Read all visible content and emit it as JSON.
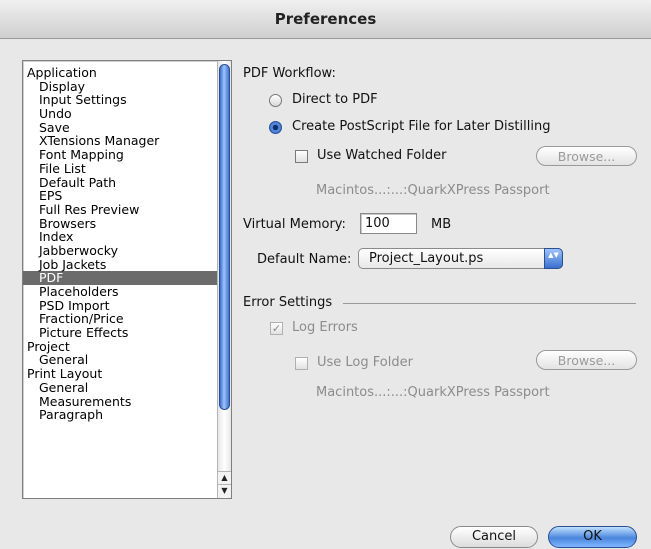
{
  "window": {
    "title": "Preferences"
  },
  "sidebar": {
    "items": [
      {
        "label": "Application",
        "level": 0
      },
      {
        "label": "Display",
        "level": 1
      },
      {
        "label": "Input Settings",
        "level": 1
      },
      {
        "label": "Undo",
        "level": 1
      },
      {
        "label": "Save",
        "level": 1
      },
      {
        "label": "XTensions Manager",
        "level": 1
      },
      {
        "label": "Font Mapping",
        "level": 1
      },
      {
        "label": "File List",
        "level": 1
      },
      {
        "label": "Default Path",
        "level": 1
      },
      {
        "label": "EPS",
        "level": 1
      },
      {
        "label": "Full Res Preview",
        "level": 1
      },
      {
        "label": "Browsers",
        "level": 1
      },
      {
        "label": "Index",
        "level": 1
      },
      {
        "label": "Jabberwocky",
        "level": 1
      },
      {
        "label": "Job Jackets",
        "level": 1
      },
      {
        "label": "PDF",
        "level": 1,
        "selected": true
      },
      {
        "label": "Placeholders",
        "level": 1
      },
      {
        "label": "PSD Import",
        "level": 1
      },
      {
        "label": "Fraction/Price",
        "level": 1
      },
      {
        "label": "Picture Effects",
        "level": 1
      },
      {
        "label": "Project",
        "level": 0
      },
      {
        "label": "General",
        "level": 1
      },
      {
        "label": "Print Layout",
        "level": 0
      },
      {
        "label": "General",
        "level": 1
      },
      {
        "label": "Measurements",
        "level": 1
      },
      {
        "label": "Paragraph",
        "level": 1
      }
    ],
    "scroll_up_glyph": "▲",
    "scroll_down_glyph": "▼"
  },
  "pdf": {
    "workflow_label": "PDF Workflow:",
    "direct_label": "Direct to PDF",
    "postscript_label": "Create PostScript File for Later Distilling",
    "selected_workflow": "postscript",
    "watched_folder_label": "Use Watched Folder",
    "watched_folder_checked": false,
    "browse_label": "Browse...",
    "watched_folder_path": "Macintos...:...:QuarkXPress Passport",
    "virtual_memory_label": "Virtual Memory:",
    "virtual_memory_value": "100",
    "virtual_memory_unit": "MB",
    "default_name_label": "Default Name:",
    "default_name_value": "Project_Layout.ps",
    "popup_arrows": "▲▼"
  },
  "errors": {
    "section_label": "Error Settings",
    "log_errors_label": "Log Errors",
    "log_errors_checked": true,
    "check_glyph": "✓",
    "use_log_folder_label": "Use Log Folder",
    "use_log_folder_checked": false,
    "browse_label": "Browse...",
    "log_folder_path": "Macintos...:...:QuarkXPress Passport"
  },
  "footer": {
    "cancel_label": "Cancel",
    "ok_label": "OK"
  }
}
